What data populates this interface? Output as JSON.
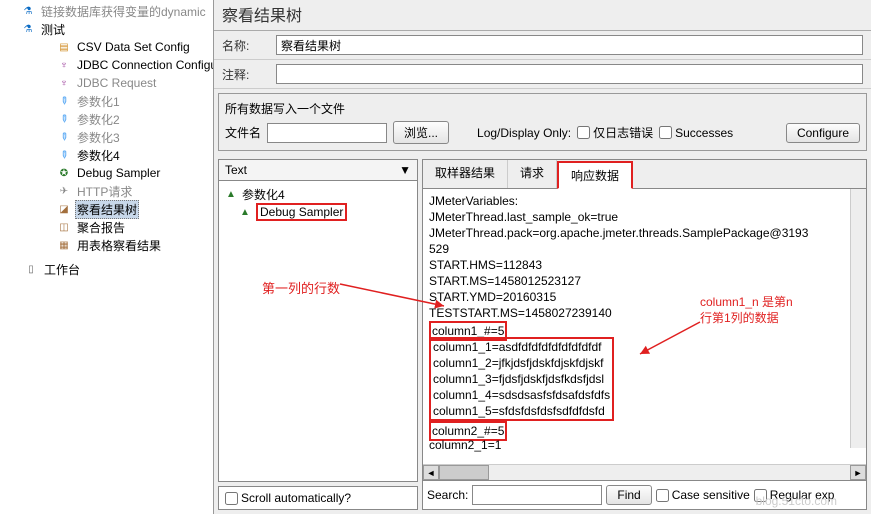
{
  "tree": {
    "topDisabled": "链接数据库获得变量的dynamic",
    "test": "测试",
    "items": [
      "CSV Data Set Config",
      "JDBC Connection Configurat",
      "JDBC Request",
      "参数化1",
      "参数化2",
      "参数化3",
      "参数化4",
      "Debug Sampler",
      "HTTP请求",
      "察看结果树",
      "聚合报告",
      "用表格察看结果"
    ],
    "workbench": "工作台"
  },
  "header": {
    "title": "察看结果树",
    "nameLabel": "名称:",
    "nameValue": "察看结果树",
    "commentLabel": "注释:"
  },
  "fileset": {
    "legend": "所有数据写入一个文件",
    "fileLabel": "文件名",
    "browse": "浏览...",
    "logLabel": "Log/Display Only:",
    "onlyErrors": "仅日志错误",
    "successes": "Successes",
    "configure": "Configure"
  },
  "leftCol": {
    "textHeader": "Text",
    "node1": "参数化4",
    "node2": "Debug Sampler",
    "scrollAuto": "Scroll automatically?"
  },
  "tabs": {
    "t1": "取样器结果",
    "t2": "请求",
    "t3": "响应数据"
  },
  "content": {
    "lines": [
      "JMeterVariables:",
      "JMeterThread.last_sample_ok=true",
      "JMeterThread.pack=org.apache.jmeter.threads.SamplePackage@3193",
      "529",
      "START.HMS=112843",
      "START.MS=1458012523127",
      "START.YMD=20160315",
      "TESTSTART.MS=1458027239140"
    ],
    "redLine1": "column1_#=5",
    "boxedLines": [
      "column1_1=asdfdfdfdfdfdfdfdfdf",
      "column1_2=jfkjdsfjdskfdjskfdjskf",
      "column1_3=fjdsfjdskfjdsfkdsfjdsl",
      "column1_4=sdsdsasfsfdsafdsfdfs",
      "column1_5=sfdsfdsfdsfsdfdfdsfd"
    ],
    "redLine2": "column2_#=5",
    "afterLines": [
      "column2_1=1"
    ]
  },
  "annotations": {
    "a1": "第一列的行数",
    "a2_l1": "column1_n 是第n",
    "a2_l2": "行第1列的数据"
  },
  "search": {
    "label": "Search:",
    "find": "Find",
    "caseSens": "Case sensitive",
    "regex": "Regular exp"
  },
  "watermark": "blog.51cto.com"
}
